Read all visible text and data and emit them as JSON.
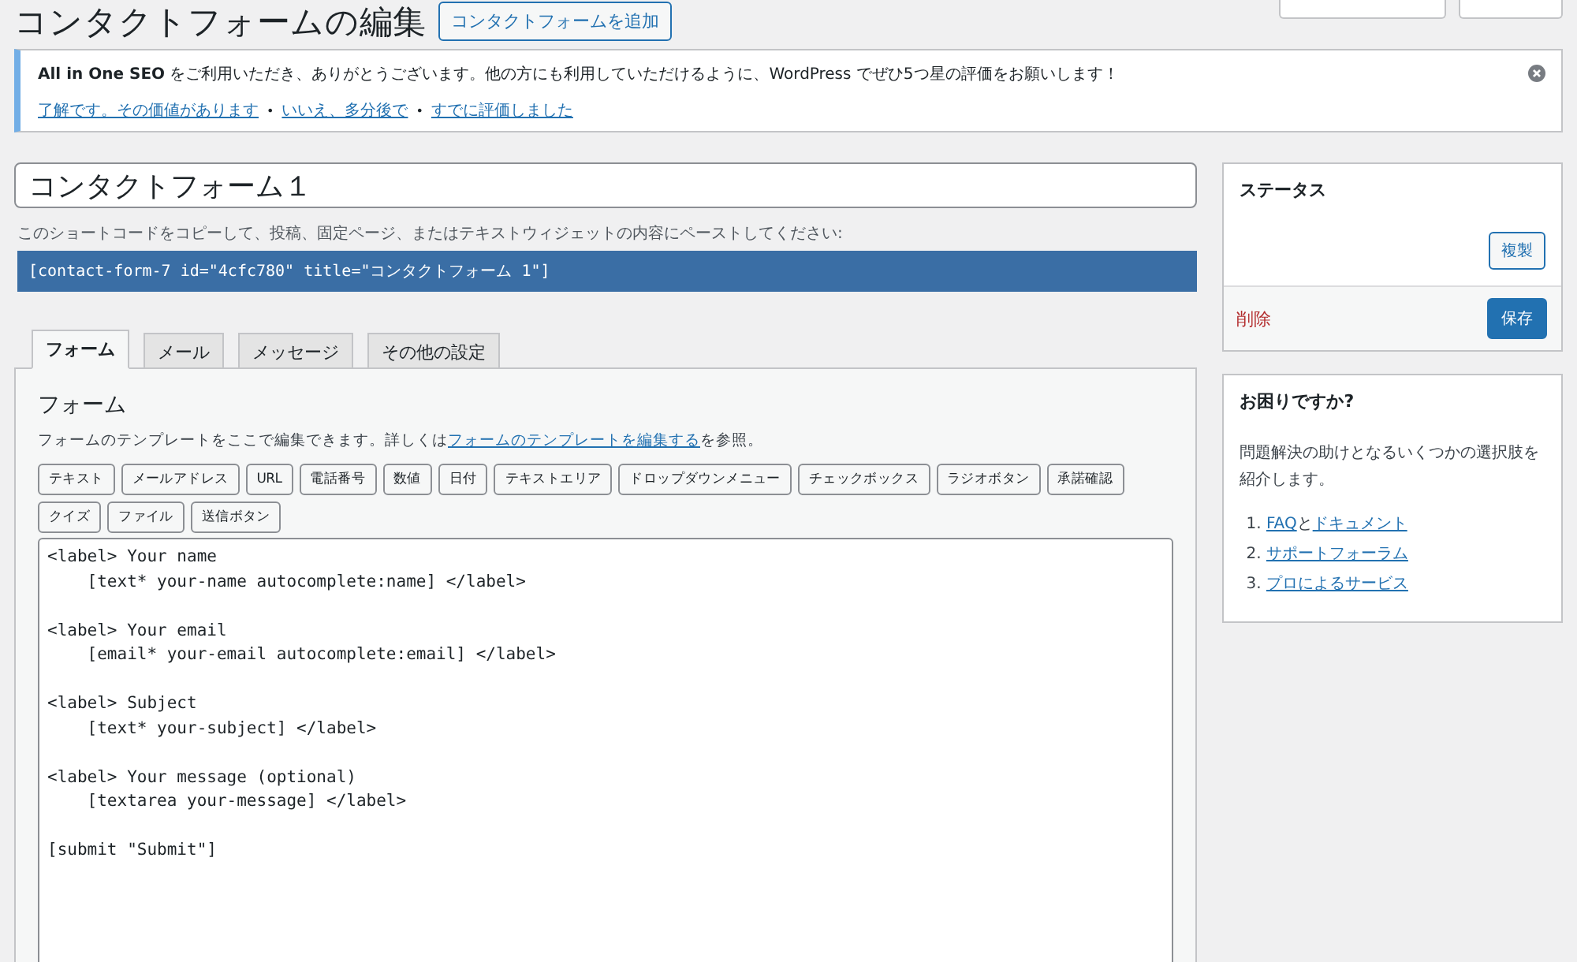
{
  "page_title": "コンタクトフォームの編集",
  "add_button": "コンタクトフォームを追加",
  "notice": {
    "message": "**All in One SEO** をご利用いただき、ありがとうございます。他の方にも利用していただけるように、WordPress でぜひ5つ星の評価をお願いします！",
    "links": [
      "了解です。その価値があります",
      "いいえ、多分後で",
      "すでに評価しました"
    ],
    "separator": "•"
  },
  "form_title": "コンタクトフォーム１",
  "shortcode_hint": "このショートコードをコピーして、投稿、固定ページ、またはテキストウィジェットの内容にペーストしてください:",
  "shortcode": "[contact-form-7 id=\"4cfc780\" title=\"コンタクトフォーム 1\"]",
  "tabs": [
    {
      "label": "フォーム",
      "selected": true
    },
    {
      "label": "メール",
      "selected": false
    },
    {
      "label": "メッセージ",
      "selected": false
    },
    {
      "label": "その他の設定",
      "selected": false
    }
  ],
  "panel": {
    "heading": "フォーム",
    "description_before": "フォームのテンプレートをここで編集できます。詳しくは",
    "description_link": "フォームのテンプレートを編集する",
    "description_after": "を参照。",
    "tag_buttons": [
      "テキスト",
      "メールアドレス",
      "URL",
      "電話番号",
      "数値",
      "日付",
      "テキストエリア",
      "ドロップダウンメニュー",
      "チェックボックス",
      "ラジオボタン",
      "承諾確認",
      "クイズ",
      "ファイル",
      "送信ボタン"
    ],
    "template": "<label> Your name\n    [text* your-name autocomplete:name] </label>\n\n<label> Your email\n    [email* your-email autocomplete:email] </label>\n\n<label> Subject\n    [text* your-subject] </label>\n\n<label> Your message (optional)\n    [textarea your-message] </label>\n\n[submit \"Submit\"]"
  },
  "status_box": {
    "title": "ステータス",
    "duplicate": "複製",
    "delete": "削除",
    "save": "保存"
  },
  "help_box": {
    "title": "お困りですか?",
    "text": "問題解決の助けとなるいくつかの選択肢を紹介します。",
    "items": [
      {
        "number": "1.",
        "parts": [
          {
            "text": "FAQ",
            "link": true
          },
          {
            "text": "と",
            "link": false
          },
          {
            "text": "ドキュメント",
            "link": true
          }
        ]
      },
      {
        "number": "2.",
        "parts": [
          {
            "text": "サポートフォーラム",
            "link": true
          }
        ]
      },
      {
        "number": "3.",
        "parts": [
          {
            "text": "プロによるサービス",
            "link": true
          }
        ]
      }
    ]
  }
}
